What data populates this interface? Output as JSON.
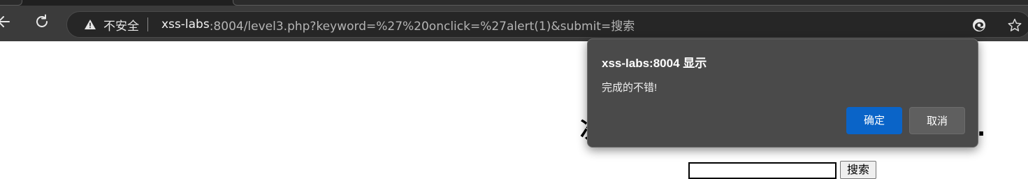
{
  "browser": {
    "security_label": "不安全",
    "url_host": "xss-labs",
    "url_rest": ":8004/level3.php?keyword=%27%20onclick=%27alert(1)&submit=搜索",
    "icons": {
      "back": "back-arrow-icon",
      "reload": "reload-icon",
      "warning": "warning-icon",
      "edge": "edge-icon",
      "favorite": "star-icon"
    }
  },
  "page": {
    "heading_fragment": "次",
    "heading_end": ".",
    "search_button_label": "搜索"
  },
  "dialog": {
    "title": "xss-labs:8004 显示",
    "message": "完成的不错!",
    "ok_label": "确定",
    "cancel_label": "取消",
    "accent_color": "#0a64c8"
  }
}
